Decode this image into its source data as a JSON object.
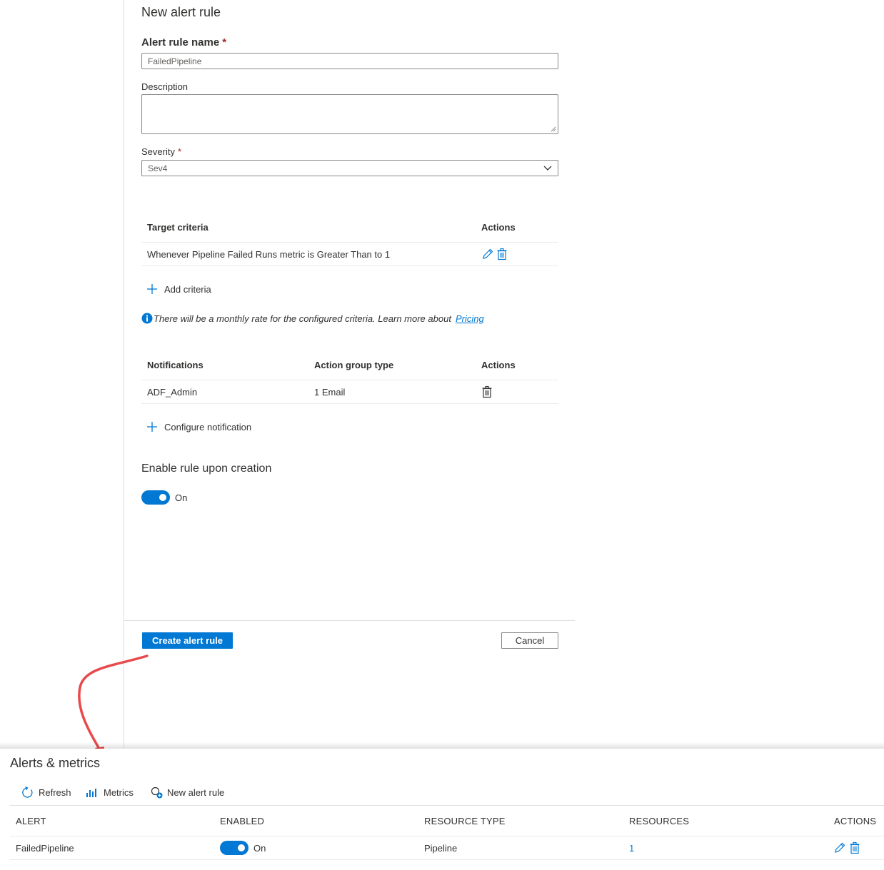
{
  "panel": {
    "title": "New alert rule",
    "rule_name_label": "Alert rule name",
    "required_mark": "*",
    "rule_name_value": "FailedPipeline",
    "description_label": "Description",
    "description_value": "",
    "severity_label": "Severity",
    "severity_value": "Sev4",
    "criteria_table": {
      "headers": [
        "Target criteria",
        "Actions"
      ],
      "rows": [
        {
          "criteria": "Whenever Pipeline Failed Runs metric is Greater Than to 1"
        }
      ]
    },
    "add_criteria_label": "Add criteria",
    "info_text": "There will be a monthly rate for the configured criteria. Learn more about",
    "pricing_link": "Pricing",
    "notifications_table": {
      "headers": [
        "Notifications",
        "Action group type",
        "Actions"
      ],
      "rows": [
        {
          "name": "ADF_Admin",
          "type": "1 Email"
        }
      ]
    },
    "configure_notification_label": "Configure notification",
    "enable_rule_label": "Enable rule upon creation",
    "enable_toggle_state": "On",
    "create_button": "Create alert rule",
    "cancel_button": "Cancel"
  },
  "alerts_metrics": {
    "title": "Alerts & metrics",
    "toolbar": {
      "refresh": "Refresh",
      "metrics": "Metrics",
      "new_alert_rule": "New alert rule"
    },
    "table": {
      "headers": [
        "ALERT",
        "ENABLED",
        "RESOURCE TYPE",
        "RESOURCES",
        "ACTIONS"
      ],
      "rows": [
        {
          "alert": "FailedPipeline",
          "enabled": "On",
          "resource_type": "Pipeline",
          "resources": "1"
        }
      ]
    }
  },
  "colors": {
    "accent": "#0078d4",
    "arrow": "#e8494b",
    "required": "#a4262c"
  },
  "icons": [
    "pencil-icon",
    "trash-icon",
    "plus-icon",
    "info-icon",
    "chevron-down-icon",
    "refresh-icon",
    "metrics-icon",
    "new-alert-icon",
    "curved-arrow"
  ]
}
